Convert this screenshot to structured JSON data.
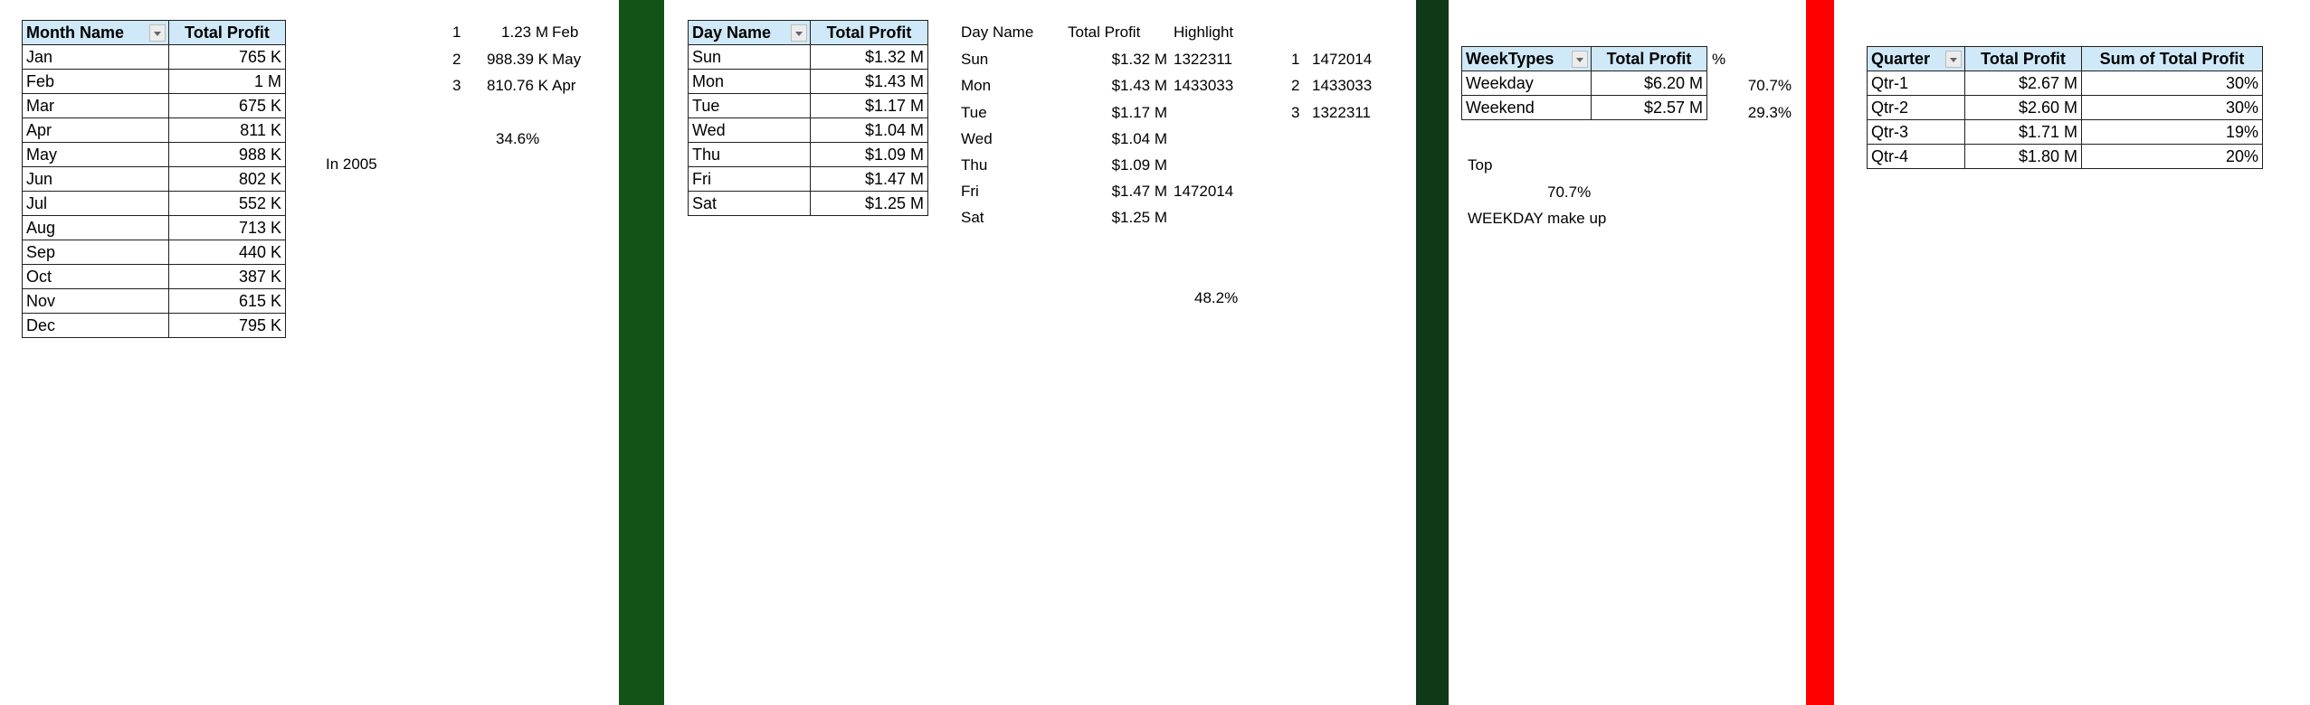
{
  "colors": {
    "header_fill": "#cfe9f8",
    "band_green_1": "#135318",
    "band_green_2": "#10391a",
    "band_red": "#ff0000"
  },
  "month_pivot": {
    "headers": [
      "Month Name",
      "Total Profit"
    ],
    "rows": [
      [
        "Jan",
        "765 K"
      ],
      [
        "Feb",
        "1 M"
      ],
      [
        "Mar",
        "675 K"
      ],
      [
        "Apr",
        "811 K"
      ],
      [
        "May",
        "988 K"
      ],
      [
        "Jun",
        "802 K"
      ],
      [
        "Jul",
        "552 K"
      ],
      [
        "Aug",
        "713 K"
      ],
      [
        "Sep",
        "440 K"
      ],
      [
        "Oct",
        "387 K"
      ],
      [
        "Nov",
        "615 K"
      ],
      [
        "Dec",
        "795 K"
      ]
    ]
  },
  "month_notes": {
    "in_year": "In 2005",
    "top3": [
      {
        "rank": "1",
        "value": "1.23 M",
        "month": "Feb"
      },
      {
        "rank": "2",
        "value": "988.39 K",
        "month": "May"
      },
      {
        "rank": "3",
        "value": "810.76 K",
        "month": "Apr"
      }
    ],
    "share": "34.6%"
  },
  "day_pivot": {
    "headers": [
      "Day Name",
      "Total Profit"
    ],
    "rows": [
      [
        "Sun",
        "$1.32 M"
      ],
      [
        "Mon",
        "$1.43 M"
      ],
      [
        "Tue",
        "$1.17 M"
      ],
      [
        "Wed",
        "$1.04 M"
      ],
      [
        "Thu",
        "$1.09 M"
      ],
      [
        "Fri",
        "$1.47 M"
      ],
      [
        "Sat",
        "$1.25 M"
      ]
    ]
  },
  "day_helper": {
    "headers": [
      "Day Name",
      "Total Profit",
      "Highlight"
    ],
    "rows": [
      [
        "Sun",
        "$1.32 M",
        "1322311"
      ],
      [
        "Mon",
        "$1.43 M",
        "1433033"
      ],
      [
        "Tue",
        "$1.17 M",
        ""
      ],
      [
        "Wed",
        "$1.04 M",
        ""
      ],
      [
        "Thu",
        "$1.09 M",
        ""
      ],
      [
        "Fri",
        "$1.47 M",
        "1472014"
      ],
      [
        "Sat",
        "$1.25 M",
        ""
      ]
    ],
    "share": "48.2%"
  },
  "day_top3": [
    {
      "rank": "1",
      "value": "1472014"
    },
    {
      "rank": "2",
      "value": "1433033"
    },
    {
      "rank": "3",
      "value": "1322311"
    }
  ],
  "week_pivot": {
    "headers": [
      "WeekTypes",
      "Total Profit"
    ],
    "pct_header": "%",
    "rows": [
      [
        "Weekday",
        "$6.20 M",
        "70.7%"
      ],
      [
        "Weekend",
        "$2.57 M",
        "29.3%"
      ]
    ]
  },
  "week_notes": {
    "top_label": "Top",
    "top_value": "70.7%",
    "caption": "WEEKDAY make up"
  },
  "quarter_pivot": {
    "headers": [
      "Quarter",
      "Total Profit",
      "Sum of Total Profit"
    ],
    "rows": [
      [
        "Qtr-1",
        "$2.67 M",
        "30%"
      ],
      [
        "Qtr-2",
        "$2.60 M",
        "30%"
      ],
      [
        "Qtr-3",
        "$1.71 M",
        "19%"
      ],
      [
        "Qtr-4",
        "$1.80 M",
        "20%"
      ]
    ]
  }
}
